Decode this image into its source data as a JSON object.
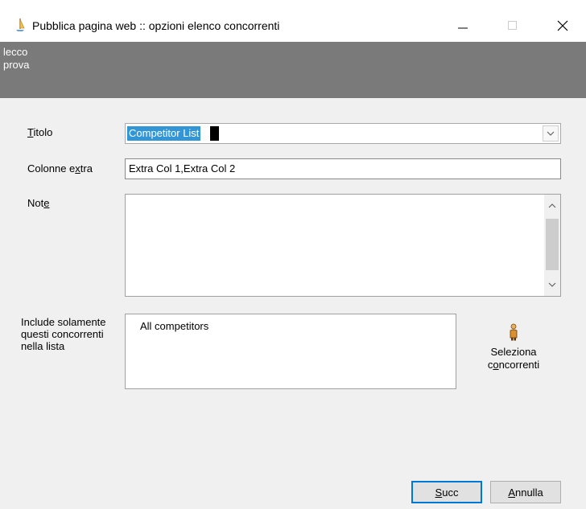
{
  "window": {
    "title": "Pubblica pagina web :: opzioni elenco concorrenti",
    "minimize_glyph": "–",
    "maximize_glyph": "□",
    "close_glyph": "✕"
  },
  "header": {
    "line1": "lecco",
    "line2": "prova"
  },
  "form": {
    "title_label_mnemonic": "T",
    "title_label_rest": "itolo",
    "title_value": "Competitor List",
    "extra_label_pre": "Colonne e",
    "extra_label_mnemonic": "x",
    "extra_label_post": "tra",
    "extra_value": "Extra Col 1,Extra Col 2",
    "note_label_pre": "Not",
    "note_label_mnemonic": "e",
    "note_value": "",
    "include_label": "Include solamente questi concorrenti nella lista",
    "competitors_value": "All competitors"
  },
  "select_button": {
    "line1": "Seleziona",
    "line2_pre": "c",
    "line2_mnemonic": "o",
    "line2_post": "ncorrenti"
  },
  "buttons": {
    "next_mnemonic": "S",
    "next_rest": "ucc",
    "cancel_mnemonic": "A",
    "cancel_rest": "nnulla"
  },
  "icons": {
    "app": "sailboat-icon",
    "select": "person-icon"
  }
}
